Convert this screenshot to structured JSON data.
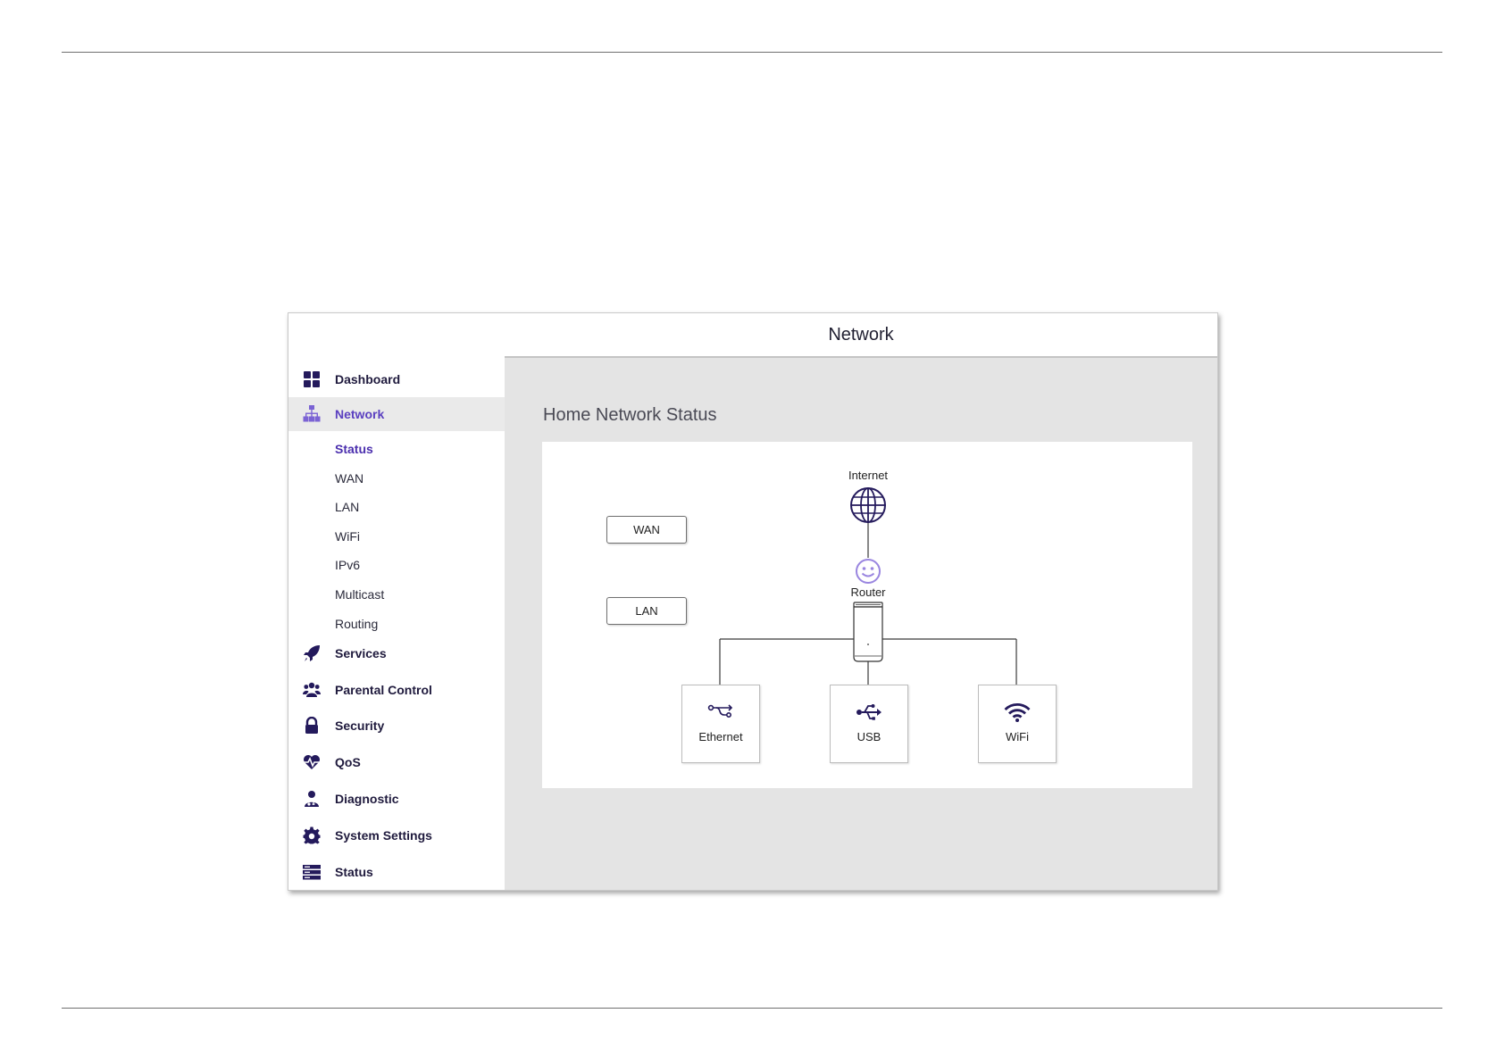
{
  "page": {
    "title": "Network"
  },
  "sidebar": {
    "items": [
      {
        "label": "Dashboard",
        "icon": "dashboard-icon"
      },
      {
        "label": "Network",
        "icon": "network-icon",
        "active": true
      },
      {
        "label": "Services",
        "icon": "rocket-icon"
      },
      {
        "label": "Parental Control",
        "icon": "users-icon"
      },
      {
        "label": "Security",
        "icon": "lock-icon"
      },
      {
        "label": "QoS",
        "icon": "heartbeat-icon"
      },
      {
        "label": "Diagnostic",
        "icon": "doctor-icon"
      },
      {
        "label": "System Settings",
        "icon": "gear-icon"
      },
      {
        "label": "Status",
        "icon": "server-icon"
      }
    ],
    "network_sub": [
      "Status",
      "WAN",
      "LAN",
      "WiFi",
      "IPv6",
      "Multicast",
      "Routing"
    ]
  },
  "main": {
    "section_title": "Home Network Status",
    "diagram": {
      "internet_label": "Internet",
      "router_label": "Router",
      "wan_button": "WAN",
      "lan_button": "LAN",
      "devices": [
        {
          "label": "Ethernet",
          "icon": "ethernet-icon"
        },
        {
          "label": "USB",
          "icon": "usb-icon"
        },
        {
          "label": "WiFi",
          "icon": "wifi-icon"
        }
      ]
    }
  },
  "colors": {
    "accent": "#5a3fc0",
    "icon_dark": "#241a5c",
    "content_bg": "#e4e4e4",
    "active_bg": "#eaeaea"
  }
}
